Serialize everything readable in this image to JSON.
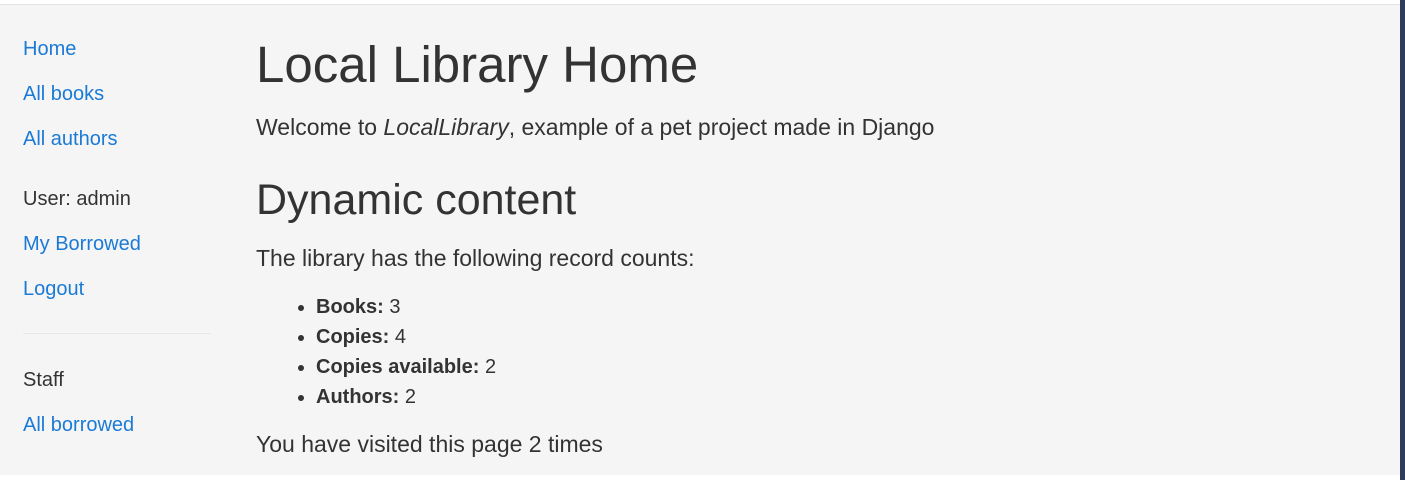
{
  "sidebar": {
    "links": {
      "home": "Home",
      "all_books": "All books",
      "all_authors": "All authors"
    },
    "user_label": "User: admin",
    "user_links": {
      "my_borrowed": "My Borrowed",
      "logout": "Logout"
    },
    "staff_label": "Staff",
    "staff_links": {
      "all_borrowed": "All borrowed"
    }
  },
  "main": {
    "title": "Local Library Home",
    "welcome": {
      "prefix": "Welcome to ",
      "brand": "LocalLibrary",
      "suffix": ", example of a pet project made in Django"
    },
    "section_title": "Dynamic content",
    "intro": "The library has the following record counts:",
    "counts": [
      {
        "label": "Books:",
        "value": "3"
      },
      {
        "label": "Copies:",
        "value": "4"
      },
      {
        "label": "Copies available:",
        "value": "2"
      },
      {
        "label": "Authors:",
        "value": "2"
      }
    ],
    "visits": "You have visited this page 2 times"
  },
  "colors": {
    "link": "#1a7ad6",
    "text": "#333333",
    "background": "#f5f5f5",
    "edge": "#2f3b5a"
  }
}
